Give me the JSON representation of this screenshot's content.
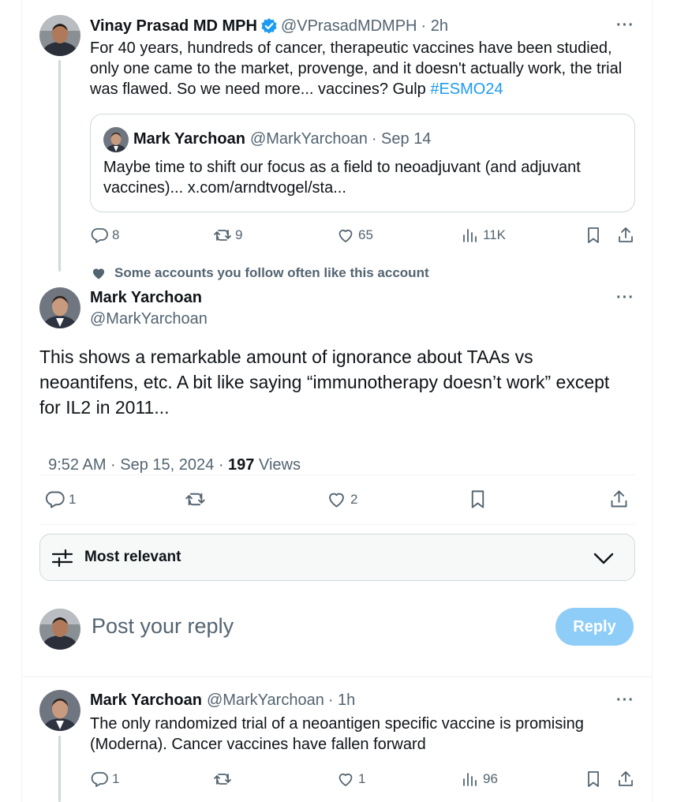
{
  "parent_tweet": {
    "name": "Vinay Prasad MD MPH",
    "handle": "@VPrasadMDMPH",
    "time": "· 2h",
    "text": "For 40 years, hundreds of cancer, therapeutic vaccines have been studied, only one came to the market, provenge, and it doesn't actually work, the trial was flawed. So we need more... vaccines? Gulp ",
    "hashtag": "#ESMO24",
    "quote": {
      "name": "Mark Yarchoan",
      "handle": "@MarkYarchoan",
      "time": "· Sep 14",
      "text": "Maybe time to shift our focus as a field to neoadjuvant (and adjuvant vaccines)... x.com/arndtvogel/sta..."
    },
    "actions": {
      "replies": "8",
      "reposts": "9",
      "likes": "65",
      "views": "11K"
    }
  },
  "social_context": "Some accounts you follow often like this account",
  "main_tweet": {
    "name": "Mark Yarchoan",
    "handle": "@MarkYarchoan",
    "text": "This shows a remarkable amount of ignorance about TAAs vs neoantifens, etc. A bit like saying “immunotherapy doesn’t work” except for IL2 in 2011...",
    "time": "9:52 AM · Sep 15, 2024 · ",
    "views_count": "197",
    "views_label": " Views",
    "actions": {
      "replies": "1",
      "likes": "2"
    }
  },
  "sort": {
    "label": "Most relevant"
  },
  "composer": {
    "placeholder": "Post your reply",
    "button": "Reply"
  },
  "reply_tweet": {
    "name": "Mark Yarchoan",
    "handle": "@MarkYarchoan",
    "time": "· 1h",
    "text": "The only randomized trial of a neoantigen specific vaccine is promising (Moderna). Cancer vaccines have fallen forward",
    "actions": {
      "replies": "1",
      "likes": "1",
      "views": "96"
    }
  },
  "colors": {
    "accent": "#1d9bf0",
    "verified": "#1d9bf0",
    "reply_button": "#8ecdf8",
    "muted": "#536471"
  },
  "icons": [
    "verified-badge-icon",
    "reply-icon",
    "repost-icon",
    "like-icon",
    "views-icon",
    "bookmark-icon",
    "share-icon",
    "heart-icon",
    "sort-icon",
    "chevron-down-icon",
    "more-icon"
  ]
}
